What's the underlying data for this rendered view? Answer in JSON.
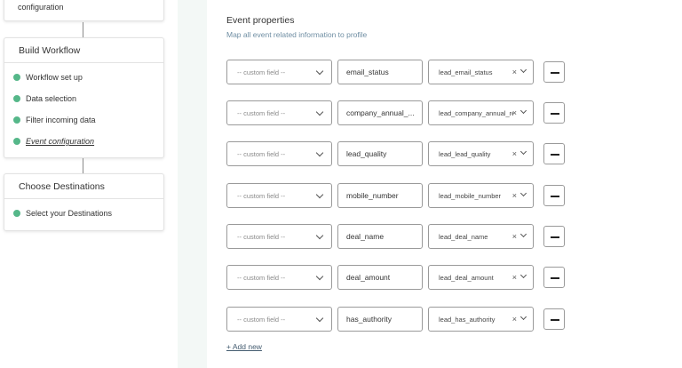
{
  "sidebar": {
    "top_card": {
      "label": "configuration"
    },
    "build_workflow": {
      "title": "Build Workflow",
      "steps": [
        {
          "label": "Workflow set up",
          "status": "done"
        },
        {
          "label": "Data selection",
          "status": "done"
        },
        {
          "label": "Filter incoming data",
          "status": "done"
        },
        {
          "label": "Event configuration",
          "status": "current"
        }
      ]
    },
    "choose_destinations": {
      "title": "Choose Destinations",
      "steps": [
        {
          "label": "Select your Destinations",
          "status": "done"
        }
      ]
    }
  },
  "main": {
    "title": "Event properties",
    "subtitle": "Map all event related information to profile",
    "rows": [
      {
        "source_placeholder": "-- custom field --",
        "property": "email_status",
        "mapped": "lead_email_status",
        "clear": "×"
      },
      {
        "source_placeholder": "-- custom field --",
        "property": "company_annual_...",
        "mapped": "lead_company_annual_re",
        "clear": "×"
      },
      {
        "source_placeholder": "-- custom field --",
        "property": "lead_quality",
        "mapped": "lead_lead_quality",
        "clear": "×"
      },
      {
        "source_placeholder": "-- custom field --",
        "property": "mobile_number",
        "mapped": "lead_mobile_number",
        "clear": "×"
      },
      {
        "source_placeholder": "-- custom field --",
        "property": "deal_name",
        "mapped": "lead_deal_name",
        "clear": "×"
      },
      {
        "source_placeholder": "-- custom field --",
        "property": "deal_amount",
        "mapped": "lead_deal_amount",
        "clear": "×"
      },
      {
        "source_placeholder": "-- custom field --",
        "property": "has_authority",
        "mapped": "lead_has_authority",
        "clear": "×"
      }
    ],
    "add_new_label": "+ Add new"
  },
  "colors": {
    "done_dot": "#55b789",
    "mint_strip": "#f3f8f6",
    "subtitle": "#6f8ea3"
  }
}
